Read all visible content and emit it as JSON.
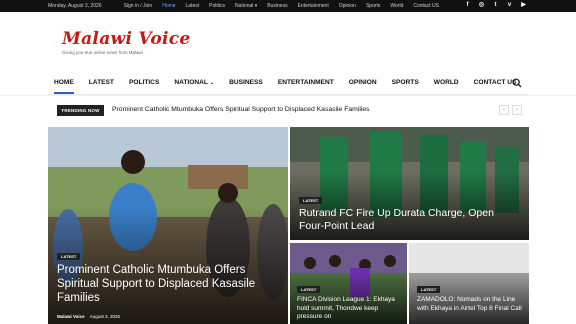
{
  "topbar": {
    "date": "Monday, August 3, 2026",
    "signin": "Sign in / Join",
    "links": [
      "Home",
      "Latest",
      "Politics",
      "National",
      "Business",
      "Entertainment",
      "Opinion",
      "Sports",
      "World",
      "Contact US"
    ],
    "social_icons": [
      "facebook-icon",
      "instagram-icon",
      "twitter-icon",
      "vimeo-icon",
      "youtube-icon"
    ]
  },
  "logo": {
    "name": "Malawi Voice",
    "tagline": "Giving you true online news from Malawi"
  },
  "nav": {
    "items": [
      "HOME",
      "LATEST",
      "POLITICS",
      "NATIONAL",
      "BUSINESS",
      "ENTERTAINMENT",
      "OPINION",
      "SPORTS",
      "WORLD",
      "CONTACT US"
    ],
    "active": "HOME"
  },
  "trending": {
    "badge": "TRENDING NOW",
    "headline": "Prominent Catholic Mtumbuka Offers Spiritual Support to Displaced Kasasile Families"
  },
  "featured": {
    "main": {
      "label": "LATEST",
      "title": "Prominent Catholic Mtumbuka Offers Spiritual Support to Displaced Kasasile Families",
      "author": "Malawi Voice",
      "date": "August 3, 2026"
    },
    "right_top": {
      "label": "LATEST",
      "title": "Rutrand FC Fire Up Durata Charge, Open Four-Point Lead"
    },
    "right_bottom_left": {
      "label": "LATEST",
      "title": "FINCA Division League 1: Ekhaya hold summit, Thondwe keep pressure on"
    },
    "right_bottom_right": {
      "label": "LATEST",
      "title": "ZAMADOLO: Nomads on the Line with Ekhaya in Airtel Top 8 Final Call"
    }
  },
  "colors": {
    "brand_red": "#c91616",
    "accent_blue": "#2b5ecf",
    "topbar_bg": "#111111"
  }
}
